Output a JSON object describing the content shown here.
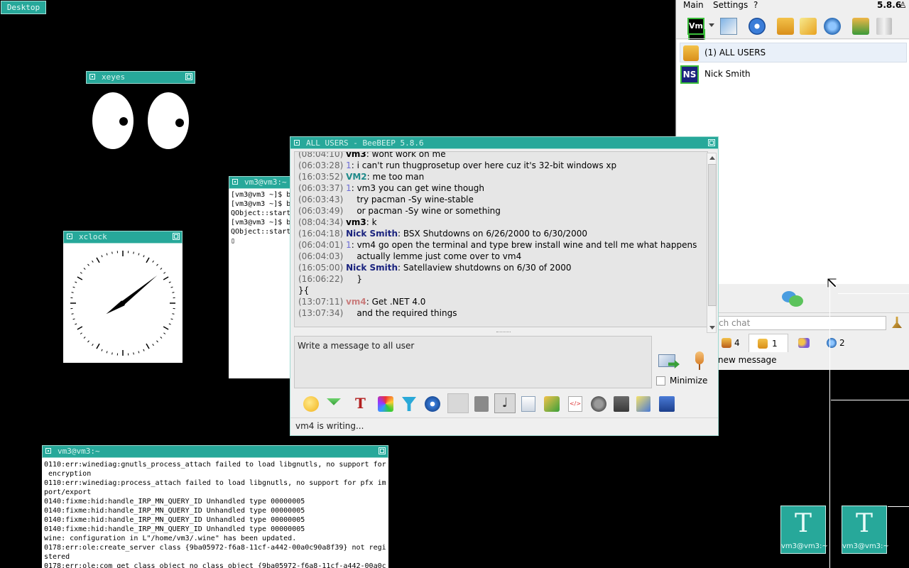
{
  "desktop": {
    "label": "Desktop"
  },
  "xeyes": {
    "title": "xeyes"
  },
  "xclock": {
    "title": "xclock"
  },
  "term_small": {
    "title": "vm3@vm3:~",
    "lines": [
      "[vm3@vm3 ~]$ b",
      "[vm3@vm3 ~]$ b",
      "QObject::start",
      "[vm3@vm3 ~]$ b",
      "QObject::start",
      "▯"
    ]
  },
  "term_big": {
    "title": "vm3@vm3:~",
    "lines": [
      "0110:err:winediag:gnutls_process_attach failed to load libgnutls, no support for",
      " encryption",
      "0110:err:winediag:process_attach failed to load libgnutls, no support for pfx im",
      "port/export",
      "0140:fixme:hid:handle_IRP_MN_QUERY_ID Unhandled type 00000005",
      "0140:fixme:hid:handle_IRP_MN_QUERY_ID Unhandled type 00000005",
      "0140:fixme:hid:handle_IRP_MN_QUERY_ID Unhandled type 00000005",
      "0140:fixme:hid:handle_IRP_MN_QUERY_ID Unhandled type 00000005",
      "wine: configuration in L\"/home/vm3/.wine\" has been updated.",
      "0178:err:ole:create_server class {9ba05972-f6a8-11cf-a442-00a0c90a8f39} not regi",
      "stered",
      "0178:err:ole:com_get_class_object no class object {9ba05972-f6a8-11cf-a442-00a0c"
    ]
  },
  "beebeep_main": {
    "menu": {
      "main": "Main",
      "settings": "Settings",
      "help": "?"
    },
    "version": "5.8.6",
    "users_header": "(1) ALL USERS",
    "user_initials": "NS",
    "user_name": "Nick Smith",
    "search_placeholder": "ch chat",
    "tabs": [
      "4",
      "1",
      "",
      "2"
    ],
    "new_message": "new message"
  },
  "chat": {
    "title": "ALL USERS - BeeBEEP 5.8.6",
    "partial_line": {
      "time": "(08:04:10)",
      "name": "vm3",
      "text": ": wont work on me"
    },
    "messages": [
      {
        "time": "(06:03:28)",
        "name": "1",
        "text": ": i can't run thugprosetup over here cuz it's 32-bit windows xp",
        "color": "#6b6bd6",
        "bold": false
      },
      {
        "time": "(16:03:52)",
        "name": "VM2",
        "text": ": me too man",
        "color": "#1f8a8a",
        "bold": true
      },
      {
        "time": "(06:03:37)",
        "name": "1",
        "text": ": vm3 you can get wine though",
        "color": "#6b6bd6",
        "bold": false
      },
      {
        "time": "(06:03:43)",
        "name": "",
        "text": "    try pacman -Sy wine-stable",
        "color": "#000000",
        "bold": false
      },
      {
        "time": "(06:03:49)",
        "name": "",
        "text": "    or pacman -Sy wine or something",
        "color": "#000000",
        "bold": false
      },
      {
        "time": "(08:04:34)",
        "name": "vm3",
        "text": ": k",
        "color": "#000000",
        "bold": true
      },
      {
        "time": "(16:04:18)",
        "name": "Nick Smith",
        "text": ": BSX Shutdowns on 6/26/2000 to 6/30/2000",
        "color": "#1a237e",
        "bold": true
      },
      {
        "time": "(06:04:01)",
        "name": "1",
        "text": ": vm4 go open the terminal and type brew install wine and tell me what happens",
        "color": "#6b6bd6",
        "bold": false
      },
      {
        "time": "(06:04:03)",
        "name": "",
        "text": "    actually lemme just come over to vm4",
        "color": "#000000",
        "bold": false
      },
      {
        "time": "(16:05:00)",
        "name": "Nick Smith",
        "text": ": Satellaview shutdowns on 6/30 of 2000",
        "color": "#1a237e",
        "bold": true
      },
      {
        "time": "(16:06:22)",
        "name": "",
        "text": "    }",
        "color": "#000000",
        "bold": false
      },
      {
        "time": "",
        "name": "",
        "text": "}{",
        "color": "#000000",
        "bold": false
      },
      {
        "time": "(13:07:11)",
        "name": "vm4",
        "text": ": Get .NET 4.0",
        "color": "#c97c7c",
        "bold": true
      },
      {
        "time": "(13:07:34)",
        "name": "",
        "text": "    and the required things",
        "color": "#000000",
        "bold": false
      }
    ],
    "input_placeholder": "Write a message to all user",
    "minimize_label": "Minimize",
    "status": "vm4 is writing..."
  },
  "icons": {
    "term1": {
      "label": "vm3@vm3:~"
    },
    "term2": {
      "label": "vm3@vm3:~"
    }
  },
  "colors": {
    "titlebar": "#27a89a",
    "background": "#000000"
  }
}
